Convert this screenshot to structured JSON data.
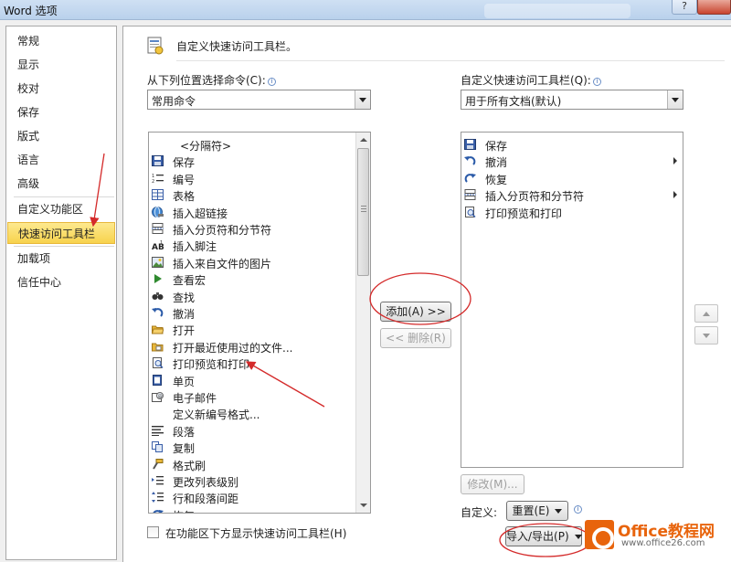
{
  "window": {
    "title": "Word 选项",
    "help_label": "?"
  },
  "sidebar": {
    "items": [
      {
        "label": "常规"
      },
      {
        "label": "显示"
      },
      {
        "label": "校对"
      },
      {
        "label": "保存"
      },
      {
        "label": "版式"
      },
      {
        "label": "语言"
      },
      {
        "label": "高级"
      },
      {
        "label": "自定义功能区"
      },
      {
        "label": "快速访问工具栏",
        "active": true
      },
      {
        "label": "加载项"
      },
      {
        "label": "信任中心"
      }
    ]
  },
  "main": {
    "heading": "自定义快速访问工具栏。",
    "choose_from_label": "从下列位置选择命令(C):",
    "choose_from_value": "常用命令",
    "customize_for_label": "自定义快速访问工具栏(Q):",
    "customize_for_value": "用于所有文档(默认)",
    "left_list": [
      {
        "label": "<分隔符>",
        "icon": "separator",
        "sub": false
      },
      {
        "label": "保存",
        "icon": "save-icon",
        "sub": false
      },
      {
        "label": "编号",
        "icon": "numbering-icon",
        "sub": true
      },
      {
        "label": "表格",
        "icon": "table-icon",
        "sub": true
      },
      {
        "label": "插入超链接",
        "icon": "hyperlink-icon",
        "sub": false
      },
      {
        "label": "插入分页符和分节符",
        "icon": "page-break-icon",
        "sub": true
      },
      {
        "label": "插入脚注",
        "icon": "footnote-icon",
        "sub": false
      },
      {
        "label": "插入来自文件的图片",
        "icon": "picture-icon",
        "sub": false
      },
      {
        "label": "查看宏",
        "icon": "macro-icon",
        "sub": false
      },
      {
        "label": "查找",
        "icon": "find-icon",
        "sub": false
      },
      {
        "label": "撤消",
        "icon": "undo-icon",
        "sub": true
      },
      {
        "label": "打开",
        "icon": "open-folder-icon",
        "sub": false
      },
      {
        "label": "打开最近使用过的文件...",
        "icon": "recent-file-icon",
        "sub": false
      },
      {
        "label": "打印预览和打印",
        "icon": "print-preview-icon",
        "sub": false
      },
      {
        "label": "单页",
        "icon": "one-page-icon",
        "sub": false
      },
      {
        "label": "电子邮件",
        "icon": "email-icon",
        "sub": false
      },
      {
        "label": "定义新编号格式...",
        "icon": "none",
        "sub": false
      },
      {
        "label": "段落",
        "icon": "paragraph-icon",
        "sub": false
      },
      {
        "label": "复制",
        "icon": "copy-icon",
        "sub": false
      },
      {
        "label": "格式刷",
        "icon": "format-painter-icon",
        "sub": false
      },
      {
        "label": "更改列表级别",
        "icon": "list-level-icon",
        "sub": true
      },
      {
        "label": "行和段落间距",
        "icon": "line-spacing-icon",
        "sub": true
      },
      {
        "label": "恢复",
        "icon": "redo-icon",
        "sub": false
      }
    ],
    "right_list": [
      {
        "label": "保存",
        "icon": "save-icon",
        "sub": false
      },
      {
        "label": "撤消",
        "icon": "undo-icon",
        "sub": true
      },
      {
        "label": "恢复",
        "icon": "redo-icon",
        "sub": false
      },
      {
        "label": "插入分页符和分节符",
        "icon": "page-break-icon",
        "sub": true
      },
      {
        "label": "打印预览和打印",
        "icon": "print-preview-icon",
        "sub": false
      }
    ],
    "add_button": "添加(A) >>",
    "remove_button": "<< 删除(R)",
    "modify_button": "修改(M)...",
    "customize_label": "自定义:",
    "reset_button": "重置(E)",
    "import_export_button": "导入/导出(P)",
    "show_below_label": "在功能区下方显示快速访问工具栏(H)"
  },
  "watermark": {
    "name": "Office教程网",
    "url": "www.office26.com"
  },
  "colors": {
    "active_nav": "#f7d24c",
    "annotation": "#d42a2a",
    "watermark": "#e8640c"
  }
}
